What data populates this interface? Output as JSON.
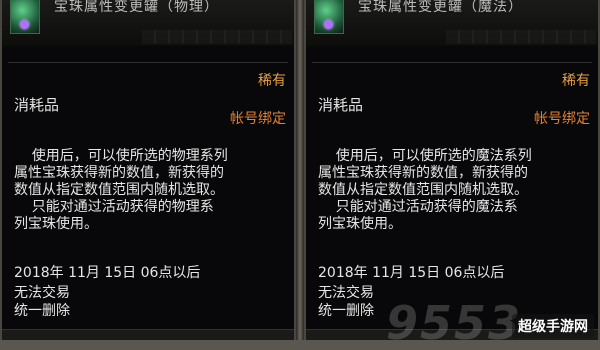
{
  "tooltips": [
    {
      "item_name": "宝珠属性变更罐（物理）",
      "rarity": "稀有",
      "type": "消耗品",
      "binding": "帐号绑定",
      "description": "    使用后，可以使所选的物理系列\n属性宝珠获得新的数值，新获得的\n数值从指定数值范围内随机选取。\n    只能对通过活动获得的物理系\n列宝珠使用。",
      "expiry": "2018年 11月 15日 06点以后",
      "trade": "无法交易",
      "unique": "统一删除"
    },
    {
      "item_name": "宝珠属性变更罐（魔法）",
      "rarity": "稀有",
      "type": "消耗品",
      "binding": "帐号绑定",
      "description": "    使用后，可以使所选的魔法系列\n属性宝珠获得新的数值，新获得的\n数值从指定数值范围内随机选取。\n    只能对通过活动获得的魔法系\n列宝珠使用。",
      "expiry": "2018年 11月 15日 06点以后",
      "trade": "无法交易",
      "unique": "统一删除"
    }
  ],
  "watermark": {
    "number": "9553",
    "site": "超级手游网"
  },
  "colors": {
    "rarity": "#e6a040",
    "binding": "#e58030",
    "text": "#e6e6e6",
    "background": "#08080a"
  },
  "icons": [
    "item-jar-icon",
    "gem-icon"
  ]
}
